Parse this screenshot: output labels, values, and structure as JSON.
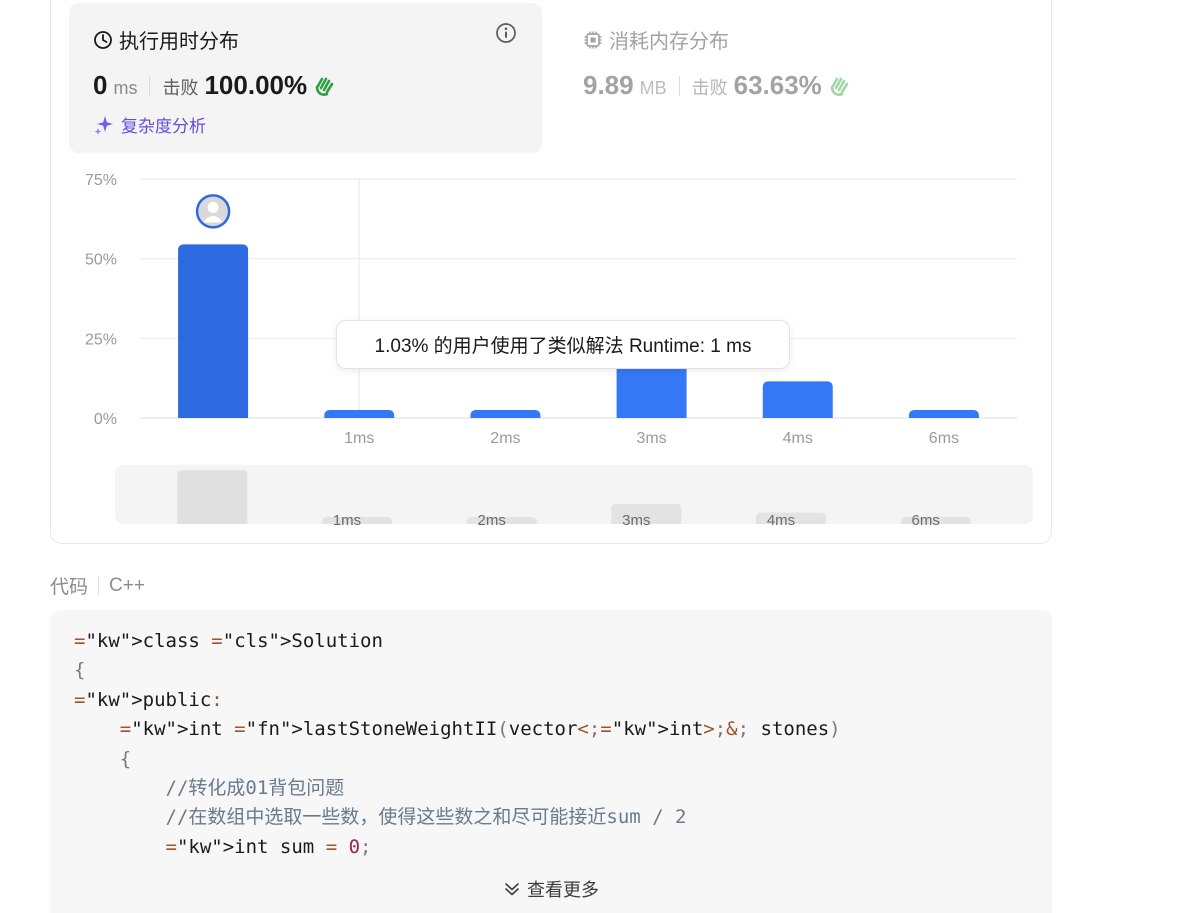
{
  "runtime": {
    "title": "执行用时分布",
    "value": "0",
    "unit": "ms",
    "beats_label": "击败",
    "beats_value": "100.00%",
    "complexity_link": "复杂度分析"
  },
  "memory": {
    "title": "消耗内存分布",
    "value": "9.89",
    "unit": "MB",
    "beats_label": "击败",
    "beats_value": "63.63%"
  },
  "tooltip": "1.03% 的用户使用了类似解法 Runtime: 1 ms",
  "chart_data": {
    "type": "bar",
    "categories": [
      "",
      "1ms",
      "2ms",
      "3ms",
      "4ms",
      "6ms"
    ],
    "values": [
      54.5,
      2.5,
      2.5,
      20.5,
      11.5,
      2.5
    ],
    "ylim": [
      0,
      75
    ],
    "yticks": [
      "0%",
      "25%",
      "50%",
      "75%"
    ],
    "ytick_values": [
      0,
      25,
      50,
      75
    ],
    "highlight_index": 0,
    "bar_color": "#3478f6",
    "highlight_color": "#2d6ae0",
    "grid": true
  },
  "navigator": {
    "labels": [
      "",
      "1ms",
      "2ms",
      "3ms",
      "4ms",
      "6ms"
    ]
  },
  "code_section": {
    "label": "代码",
    "language": "C++",
    "show_more": "查看更多",
    "lines": [
      "class Solution",
      "{",
      "public:",
      "    int lastStoneWeightII(vector<int>& stones)",
      "    {",
      "        //转化成01背包问题",
      "        //在数组中选取一些数，使得这些数之和尽可能接近sum / 2",
      "        int sum = 0;"
    ]
  },
  "colors": {
    "accent": "#3478f6",
    "complexity": "#6b4bd6"
  }
}
